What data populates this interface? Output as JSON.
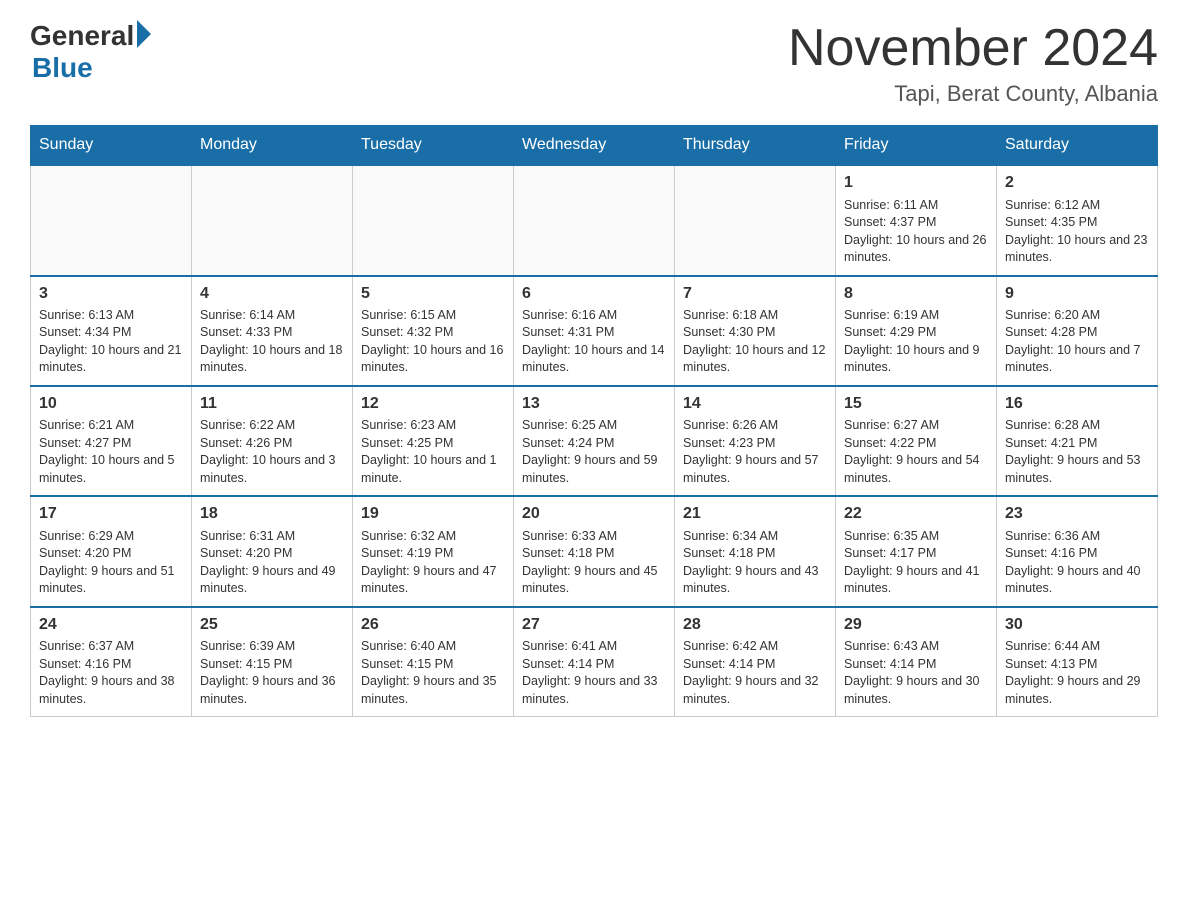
{
  "logo": {
    "general": "General",
    "blue": "Blue"
  },
  "title": "November 2024",
  "location": "Tapi, Berat County, Albania",
  "days_of_week": [
    "Sunday",
    "Monday",
    "Tuesday",
    "Wednesday",
    "Thursday",
    "Friday",
    "Saturday"
  ],
  "weeks": [
    [
      {
        "day": "",
        "sunrise": "",
        "sunset": "",
        "daylight": ""
      },
      {
        "day": "",
        "sunrise": "",
        "sunset": "",
        "daylight": ""
      },
      {
        "day": "",
        "sunrise": "",
        "sunset": "",
        "daylight": ""
      },
      {
        "day": "",
        "sunrise": "",
        "sunset": "",
        "daylight": ""
      },
      {
        "day": "",
        "sunrise": "",
        "sunset": "",
        "daylight": ""
      },
      {
        "day": "1",
        "sunrise": "Sunrise: 6:11 AM",
        "sunset": "Sunset: 4:37 PM",
        "daylight": "Daylight: 10 hours and 26 minutes."
      },
      {
        "day": "2",
        "sunrise": "Sunrise: 6:12 AM",
        "sunset": "Sunset: 4:35 PM",
        "daylight": "Daylight: 10 hours and 23 minutes."
      }
    ],
    [
      {
        "day": "3",
        "sunrise": "Sunrise: 6:13 AM",
        "sunset": "Sunset: 4:34 PM",
        "daylight": "Daylight: 10 hours and 21 minutes."
      },
      {
        "day": "4",
        "sunrise": "Sunrise: 6:14 AM",
        "sunset": "Sunset: 4:33 PM",
        "daylight": "Daylight: 10 hours and 18 minutes."
      },
      {
        "day": "5",
        "sunrise": "Sunrise: 6:15 AM",
        "sunset": "Sunset: 4:32 PM",
        "daylight": "Daylight: 10 hours and 16 minutes."
      },
      {
        "day": "6",
        "sunrise": "Sunrise: 6:16 AM",
        "sunset": "Sunset: 4:31 PM",
        "daylight": "Daylight: 10 hours and 14 minutes."
      },
      {
        "day": "7",
        "sunrise": "Sunrise: 6:18 AM",
        "sunset": "Sunset: 4:30 PM",
        "daylight": "Daylight: 10 hours and 12 minutes."
      },
      {
        "day": "8",
        "sunrise": "Sunrise: 6:19 AM",
        "sunset": "Sunset: 4:29 PM",
        "daylight": "Daylight: 10 hours and 9 minutes."
      },
      {
        "day": "9",
        "sunrise": "Sunrise: 6:20 AM",
        "sunset": "Sunset: 4:28 PM",
        "daylight": "Daylight: 10 hours and 7 minutes."
      }
    ],
    [
      {
        "day": "10",
        "sunrise": "Sunrise: 6:21 AM",
        "sunset": "Sunset: 4:27 PM",
        "daylight": "Daylight: 10 hours and 5 minutes."
      },
      {
        "day": "11",
        "sunrise": "Sunrise: 6:22 AM",
        "sunset": "Sunset: 4:26 PM",
        "daylight": "Daylight: 10 hours and 3 minutes."
      },
      {
        "day": "12",
        "sunrise": "Sunrise: 6:23 AM",
        "sunset": "Sunset: 4:25 PM",
        "daylight": "Daylight: 10 hours and 1 minute."
      },
      {
        "day": "13",
        "sunrise": "Sunrise: 6:25 AM",
        "sunset": "Sunset: 4:24 PM",
        "daylight": "Daylight: 9 hours and 59 minutes."
      },
      {
        "day": "14",
        "sunrise": "Sunrise: 6:26 AM",
        "sunset": "Sunset: 4:23 PM",
        "daylight": "Daylight: 9 hours and 57 minutes."
      },
      {
        "day": "15",
        "sunrise": "Sunrise: 6:27 AM",
        "sunset": "Sunset: 4:22 PM",
        "daylight": "Daylight: 9 hours and 54 minutes."
      },
      {
        "day": "16",
        "sunrise": "Sunrise: 6:28 AM",
        "sunset": "Sunset: 4:21 PM",
        "daylight": "Daylight: 9 hours and 53 minutes."
      }
    ],
    [
      {
        "day": "17",
        "sunrise": "Sunrise: 6:29 AM",
        "sunset": "Sunset: 4:20 PM",
        "daylight": "Daylight: 9 hours and 51 minutes."
      },
      {
        "day": "18",
        "sunrise": "Sunrise: 6:31 AM",
        "sunset": "Sunset: 4:20 PM",
        "daylight": "Daylight: 9 hours and 49 minutes."
      },
      {
        "day": "19",
        "sunrise": "Sunrise: 6:32 AM",
        "sunset": "Sunset: 4:19 PM",
        "daylight": "Daylight: 9 hours and 47 minutes."
      },
      {
        "day": "20",
        "sunrise": "Sunrise: 6:33 AM",
        "sunset": "Sunset: 4:18 PM",
        "daylight": "Daylight: 9 hours and 45 minutes."
      },
      {
        "day": "21",
        "sunrise": "Sunrise: 6:34 AM",
        "sunset": "Sunset: 4:18 PM",
        "daylight": "Daylight: 9 hours and 43 minutes."
      },
      {
        "day": "22",
        "sunrise": "Sunrise: 6:35 AM",
        "sunset": "Sunset: 4:17 PM",
        "daylight": "Daylight: 9 hours and 41 minutes."
      },
      {
        "day": "23",
        "sunrise": "Sunrise: 6:36 AM",
        "sunset": "Sunset: 4:16 PM",
        "daylight": "Daylight: 9 hours and 40 minutes."
      }
    ],
    [
      {
        "day": "24",
        "sunrise": "Sunrise: 6:37 AM",
        "sunset": "Sunset: 4:16 PM",
        "daylight": "Daylight: 9 hours and 38 minutes."
      },
      {
        "day": "25",
        "sunrise": "Sunrise: 6:39 AM",
        "sunset": "Sunset: 4:15 PM",
        "daylight": "Daylight: 9 hours and 36 minutes."
      },
      {
        "day": "26",
        "sunrise": "Sunrise: 6:40 AM",
        "sunset": "Sunset: 4:15 PM",
        "daylight": "Daylight: 9 hours and 35 minutes."
      },
      {
        "day": "27",
        "sunrise": "Sunrise: 6:41 AM",
        "sunset": "Sunset: 4:14 PM",
        "daylight": "Daylight: 9 hours and 33 minutes."
      },
      {
        "day": "28",
        "sunrise": "Sunrise: 6:42 AM",
        "sunset": "Sunset: 4:14 PM",
        "daylight": "Daylight: 9 hours and 32 minutes."
      },
      {
        "day": "29",
        "sunrise": "Sunrise: 6:43 AM",
        "sunset": "Sunset: 4:14 PM",
        "daylight": "Daylight: 9 hours and 30 minutes."
      },
      {
        "day": "30",
        "sunrise": "Sunrise: 6:44 AM",
        "sunset": "Sunset: 4:13 PM",
        "daylight": "Daylight: 9 hours and 29 minutes."
      }
    ]
  ]
}
